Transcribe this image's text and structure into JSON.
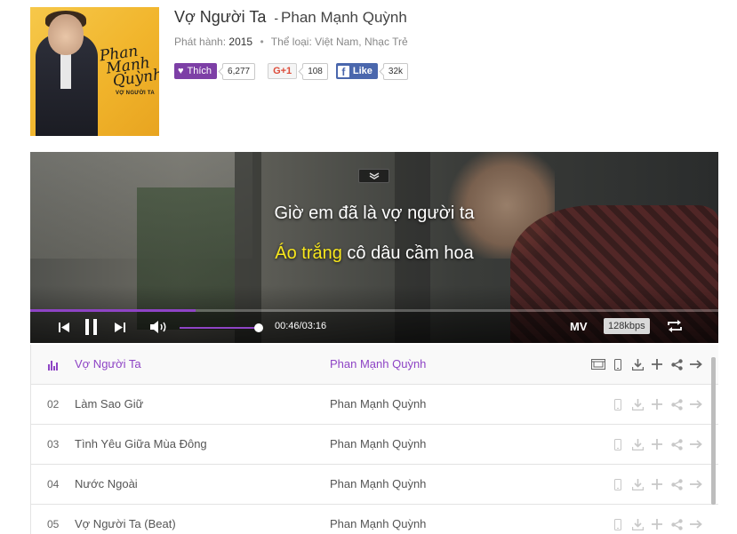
{
  "album": {
    "cover_alt": "Vợ Người Ta cover",
    "cover_signature": "Phan Mạnh Quỳnh",
    "cover_subtitle": "VỢ NGƯỜI TA"
  },
  "song": {
    "title": "Vợ Người Ta",
    "separator": "-",
    "artist": "Phan Mạnh Quỳnh",
    "release_label": "Phát hành:",
    "release_year": "2015",
    "dot": "•",
    "genre_label": "Thể loại:",
    "genres": "Việt Nam, Nhạc Trẻ"
  },
  "social": {
    "like_label": "Thích",
    "like_count": "6,277",
    "gplus_label": "G+1",
    "gplus_count": "108",
    "fb_label": "Like",
    "fb_count": "32k"
  },
  "player": {
    "collapse_icon": "chevron-down-icon",
    "lyric_line1": "Giờ em đã là vợ người ta",
    "lyric_line2_highlight": "Áo trắng",
    "lyric_line2_rest": " cô dâu cầm hoa",
    "progress_fraction": 0.24,
    "volume_fraction": 1.0,
    "time": "00:46/03:16",
    "mv_label": "MV",
    "quality": "128kbps",
    "highlight_color": "#f8e71c",
    "accent_color": "#8e44c5"
  },
  "playlist": [
    {
      "num": "",
      "title": "Vợ Người Ta",
      "artist": "Phan Mạnh Quỳnh",
      "active": true
    },
    {
      "num": "02",
      "title": "Làm Sao Giữ",
      "artist": "Phan Mạnh Quỳnh",
      "active": false
    },
    {
      "num": "03",
      "title": "Tình Yêu Giữa Mùa Đông",
      "artist": "Phan Mạnh Quỳnh",
      "active": false
    },
    {
      "num": "04",
      "title": "Nước Ngoài",
      "artist": "Phan Mạnh Quỳnh",
      "active": false
    },
    {
      "num": "05",
      "title": "Vợ Người Ta (Beat)",
      "artist": "Phan Mạnh Quỳnh",
      "active": false
    }
  ]
}
